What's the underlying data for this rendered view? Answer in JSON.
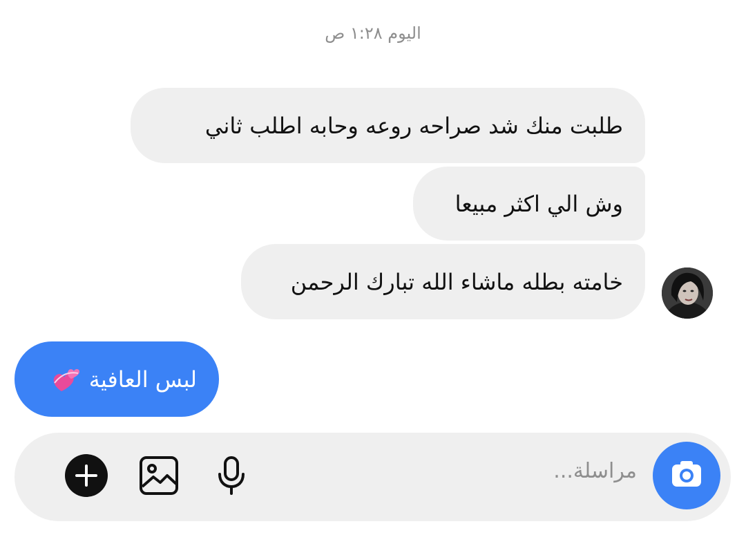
{
  "conversation": {
    "timestamp": "اليوم ١:٢٨ ص",
    "received_messages": [
      {
        "text": "طلبت منك شد صراحه روعه وحابه اطلب ثاني"
      },
      {
        "text": "وش الي اكثر مبيعا"
      },
      {
        "text": "خامته بطله ماشاء الله تبارك الرحمن"
      }
    ],
    "sent_messages": [
      {
        "text": "لبس العافية",
        "emoji_icon": "two-hearts-icon"
      }
    ]
  },
  "composer": {
    "placeholder": "مراسلة...",
    "icons": {
      "camera": "camera-icon",
      "mic": "microphone-icon",
      "gallery": "image-icon",
      "add": "plus-icon"
    }
  },
  "colors": {
    "sent_bubble": "#3b82f6",
    "received_bubble": "#efefef",
    "composer_bg": "#efefef",
    "camera_button": "#3b82f6"
  }
}
